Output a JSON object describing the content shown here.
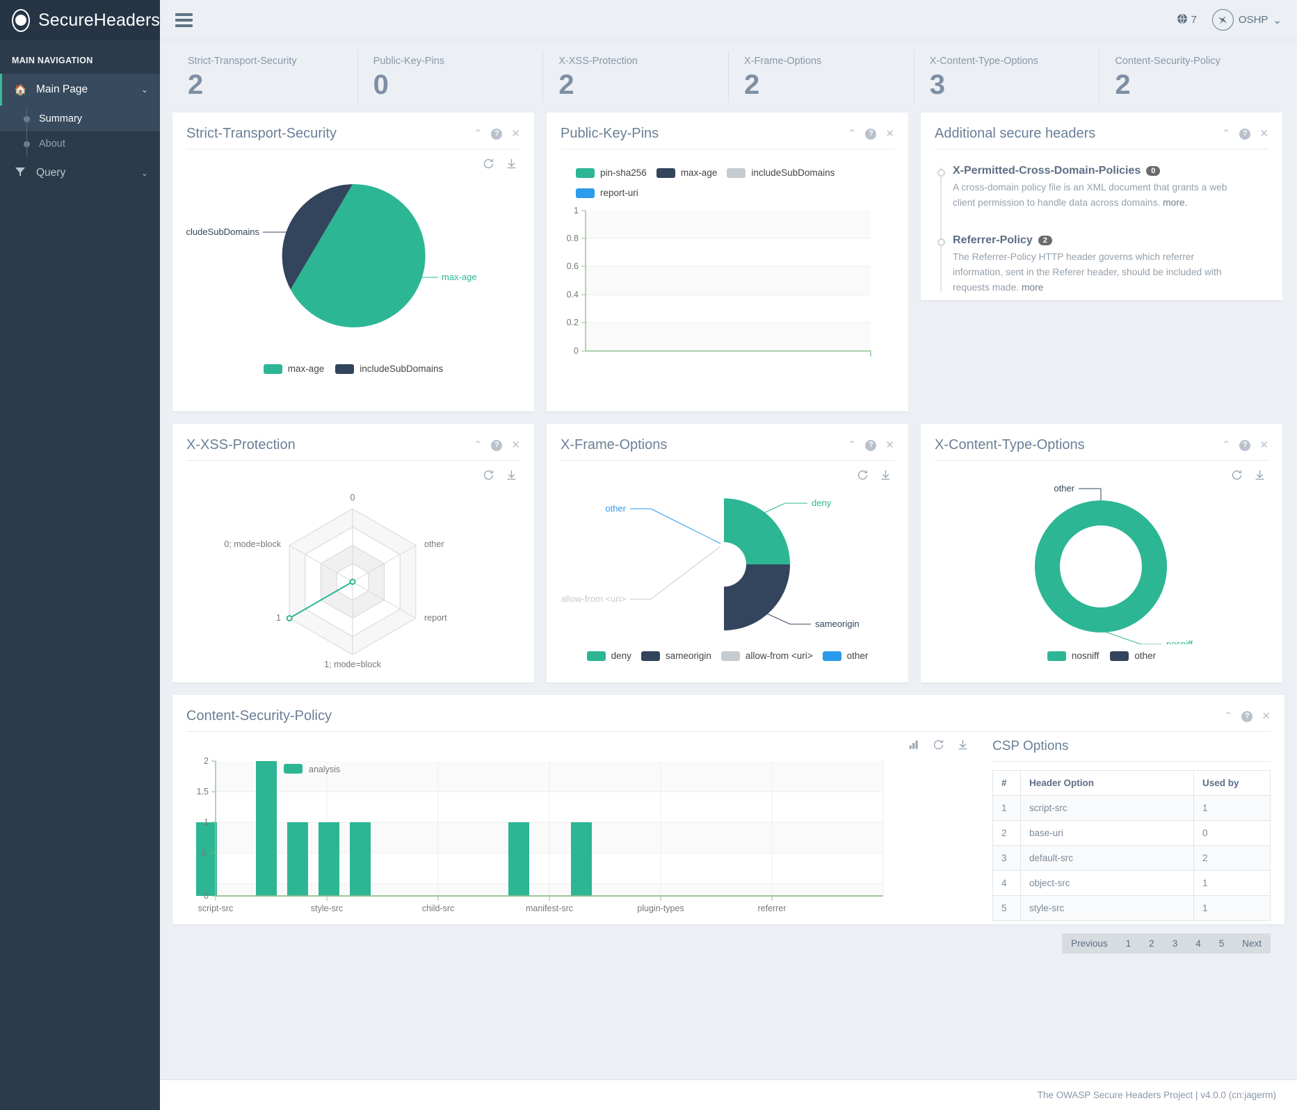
{
  "brand": {
    "name": "SecureHeaders",
    "logo_icon": "circle-dot-icon"
  },
  "sidebar": {
    "nav_header": "MAIN NAVIGATION",
    "items": [
      {
        "label": "Main Page",
        "icon": "home-icon",
        "chevron": "⌄",
        "active": true
      },
      {
        "label": "Query",
        "icon": "filter-icon",
        "chevron": "⌄",
        "active": false
      }
    ],
    "subitems": [
      {
        "label": "Summary",
        "active": true
      },
      {
        "label": "About",
        "active": false
      }
    ]
  },
  "topbar": {
    "menu_icon": "hamburger-icon",
    "globe_icon": "globe-icon",
    "globe_count": "7",
    "avatar_icon": "airplane-icon",
    "user_label": "OSHP",
    "user_chevron": "⌄"
  },
  "stats": [
    {
      "label": "Strict-Transport-Security",
      "value": "2"
    },
    {
      "label": "Public-Key-Pins",
      "value": "0"
    },
    {
      "label": "X-XSS-Protection",
      "value": "2"
    },
    {
      "label": "X-Frame-Options",
      "value": "2"
    },
    {
      "label": "X-Content-Type-Options",
      "value": "3"
    },
    {
      "label": "Content-Security-Policy",
      "value": "2"
    }
  ],
  "panel_tools": {
    "collapse": "⌃",
    "help": "?",
    "close": "✕"
  },
  "chart_tools": {
    "refresh": "refresh-icon",
    "download": "download-icon",
    "bars": "bar-chart-icon"
  },
  "panels": {
    "sts": {
      "title": "Strict-Transport-Security"
    },
    "pkp": {
      "title": "Public-Key-Pins"
    },
    "additional": {
      "title": "Additional secure headers"
    },
    "xss": {
      "title": "X-XSS-Protection"
    },
    "xfo": {
      "title": "X-Frame-Options"
    },
    "xcto": {
      "title": "X-Content-Type-Options"
    },
    "csp": {
      "title": "Content-Security-Policy"
    }
  },
  "additional_headers": [
    {
      "name": "X-Permitted-Cross-Domain-Policies",
      "badge": "0",
      "desc": "A cross-domain policy file is an XML document that grants a web client permission to handle data across domains. ",
      "more": "more."
    },
    {
      "name": "Referrer-Policy",
      "badge": "2",
      "desc": "The Referrer-Policy HTTP header governs which referrer information, sent in the Referer header, should be included with requests made. ",
      "more": "more"
    }
  ],
  "csp_options": {
    "title": "CSP Options",
    "columns": [
      "#",
      "Header Option",
      "Used by"
    ],
    "rows": [
      {
        "num": "1",
        "option": "script-src",
        "used": "1"
      },
      {
        "num": "2",
        "option": "base-uri",
        "used": "0"
      },
      {
        "num": "3",
        "option": "default-src",
        "used": "2"
      },
      {
        "num": "4",
        "option": "object-src",
        "used": "1"
      },
      {
        "num": "5",
        "option": "style-src",
        "used": "1"
      }
    ],
    "pager": [
      "Previous",
      "1",
      "2",
      "3",
      "4",
      "5",
      "Next"
    ]
  },
  "footer": {
    "text": "The OWASP Secure Headers Project | v4.0.0 (cn:jagerm)"
  },
  "colors": {
    "teal": "#2cb694",
    "navy": "#32455c",
    "gray": "#c6cbd1",
    "blue": "#2b9cec",
    "sidebar": "#2c3b4c",
    "accent": "#3bbb9b"
  },
  "chart_data": [
    {
      "id": "sts-pie",
      "type": "pie",
      "title": "Strict-Transport-Security",
      "labels": [
        "max-age",
        "includeSubDomains"
      ],
      "values": [
        2,
        1
      ],
      "colors": [
        "#2cb694",
        "#32455c"
      ],
      "legend": [
        "max-age",
        "includeSubDomains"
      ],
      "legend_position": "bottom",
      "annotations": [
        "includeSubDomains",
        "max-age"
      ]
    },
    {
      "id": "pkp-bar",
      "type": "bar",
      "title": "Public-Key-Pins",
      "categories": [],
      "series": [
        {
          "name": "pin-sha256",
          "values": [],
          "color": "#2cb694"
        },
        {
          "name": "max-age",
          "values": [],
          "color": "#32455c"
        },
        {
          "name": "includeSubDomains",
          "values": [],
          "color": "#c6cbd1"
        },
        {
          "name": "report-uri",
          "values": [],
          "color": "#2b9cec"
        }
      ],
      "ylim": [
        0,
        1
      ],
      "yticks": [
        "0",
        "0.2",
        "0.4",
        "0.6",
        "0.8",
        "1"
      ],
      "grid": true,
      "legend_position": "top",
      "xlabel": "",
      "ylabel": ""
    },
    {
      "id": "xss-radar",
      "type": "radar",
      "title": "X-XSS-Protection",
      "axes": [
        "0",
        "other",
        "report",
        "1; mode=block",
        "1",
        "0; mode=block"
      ],
      "values": [
        0,
        0,
        0,
        0,
        1,
        0
      ],
      "rmax": 1,
      "rings": 4,
      "color": "#2cb694"
    },
    {
      "id": "xfo-donut",
      "type": "pie",
      "title": "X-Frame-Options",
      "labels": [
        "deny",
        "sameorigin",
        "allow-from <uri>",
        "other"
      ],
      "values": [
        1,
        1,
        0,
        0
      ],
      "colors": [
        "#2cb694",
        "#32455c",
        "#c6cbd1",
        "#2b9cec"
      ],
      "legend": [
        "deny",
        "sameorigin",
        "allow-from <uri>",
        "other"
      ],
      "legend_position": "bottom",
      "donut": true,
      "annotations": [
        "deny",
        "sameorigin",
        "other",
        "allow-from <uri>"
      ]
    },
    {
      "id": "xcto-donut",
      "type": "pie",
      "title": "X-Content-Type-Options",
      "labels": [
        "nosniff",
        "other"
      ],
      "values": [
        3,
        0
      ],
      "colors": [
        "#2cb694",
        "#32455c"
      ],
      "legend": [
        "nosniff",
        "other"
      ],
      "legend_position": "bottom",
      "donut": true,
      "annotations": [
        "other",
        "nosniff"
      ]
    },
    {
      "id": "csp-bar",
      "type": "bar",
      "title": "Content-Security-Policy",
      "series_name": "analysis",
      "color": "#2cb694",
      "tick_labels": [
        "script-src",
        "style-src",
        "child-src",
        "manifest-src",
        "plugin-types",
        "referrer"
      ],
      "values": [
        1,
        0,
        2,
        1,
        1,
        1,
        0,
        0,
        0,
        1,
        0,
        1,
        0,
        0,
        0,
        0,
        0,
        0
      ],
      "ylim": [
        0,
        2
      ],
      "yticks": [
        "0",
        "0.5",
        "1",
        "1.5",
        "2"
      ],
      "grid": true,
      "legend": [
        "analysis"
      ],
      "legend_position": "top"
    }
  ]
}
